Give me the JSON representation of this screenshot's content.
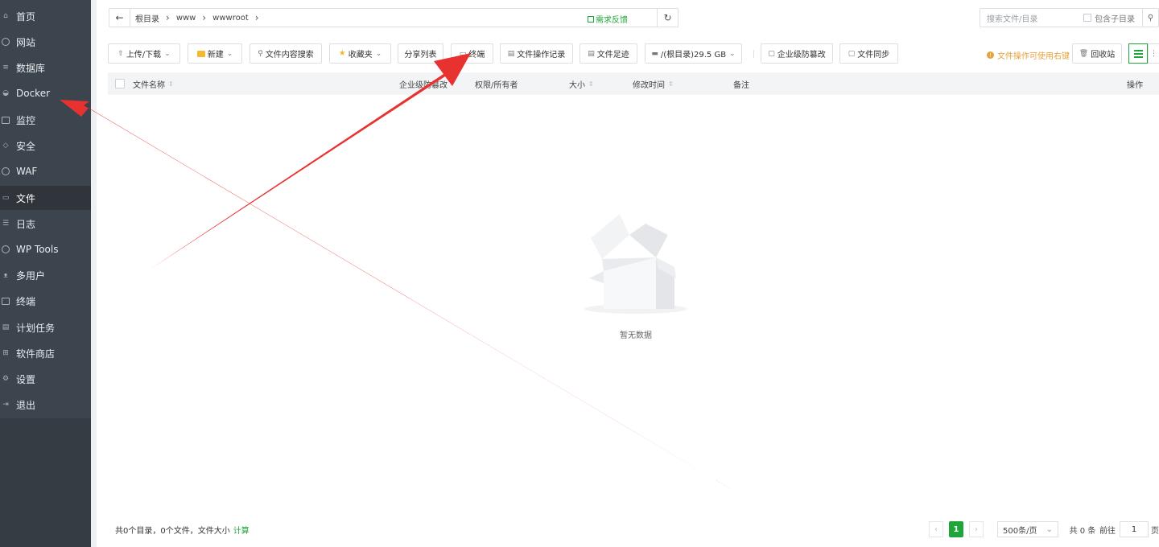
{
  "sidebar": {
    "items": [
      {
        "label": "首页",
        "icon": "home-icon"
      },
      {
        "label": "网站",
        "icon": "globe-icon"
      },
      {
        "label": "数据库",
        "icon": "database-icon"
      },
      {
        "label": "Docker",
        "icon": "docker-icon"
      },
      {
        "label": "监控",
        "icon": "monitor-icon"
      },
      {
        "label": "安全",
        "icon": "shield-icon"
      },
      {
        "label": "WAF",
        "icon": "waf-shield-icon"
      },
      {
        "label": "文件",
        "icon": "folder-icon",
        "active": true
      },
      {
        "label": "日志",
        "icon": "log-icon"
      },
      {
        "label": "WP Tools",
        "icon": "wordpress-icon"
      },
      {
        "label": "多用户",
        "icon": "users-icon"
      },
      {
        "label": "终端",
        "icon": "terminal-icon"
      },
      {
        "label": "计划任务",
        "icon": "calendar-icon"
      },
      {
        "label": "软件商店",
        "icon": "grid-icon"
      },
      {
        "label": "设置",
        "icon": "gear-icon"
      },
      {
        "label": "退出",
        "icon": "logout-icon"
      }
    ]
  },
  "pathbar": {
    "crumbs": [
      "根目录",
      "www",
      "wwwroot"
    ],
    "feedback": "需求反馈"
  },
  "search": {
    "placeholder": "搜索文件/目录",
    "include_sub": "包含子目录"
  },
  "toolbar": {
    "upload": "上传/下载",
    "new": "新建",
    "content_search": "文件内容搜索",
    "favorites": "收藏夹",
    "share_list": "分享列表",
    "terminal": "终端",
    "op_log": "文件操作记录",
    "footprint": "文件足迹",
    "disk": "/(根目录)29.5 GB",
    "tamper": "企业级防篡改",
    "sync": "文件同步",
    "tip": "文件操作可使用右键",
    "recycle": "回收站"
  },
  "table": {
    "columns": {
      "name": "文件名称",
      "tamper": "企业级防篡改",
      "perm": "权限/所有者",
      "size": "大小",
      "mtime": "修改时间",
      "remark": "备注",
      "ops": "操作"
    },
    "empty_text": "暂无数据"
  },
  "footer": {
    "summary": "共0个目录，0个文件，文件大小",
    "calc": "计算",
    "current_page": "1",
    "page_size": "500条/页",
    "total": "共 0 条",
    "goto_label": "前往",
    "goto_value": "1",
    "page_unit": "页"
  },
  "colors": {
    "sidebar": "#3c444d",
    "accent_green": "#20a53a",
    "warning": "#e6a23c",
    "annotation_red": "#e8322f"
  }
}
